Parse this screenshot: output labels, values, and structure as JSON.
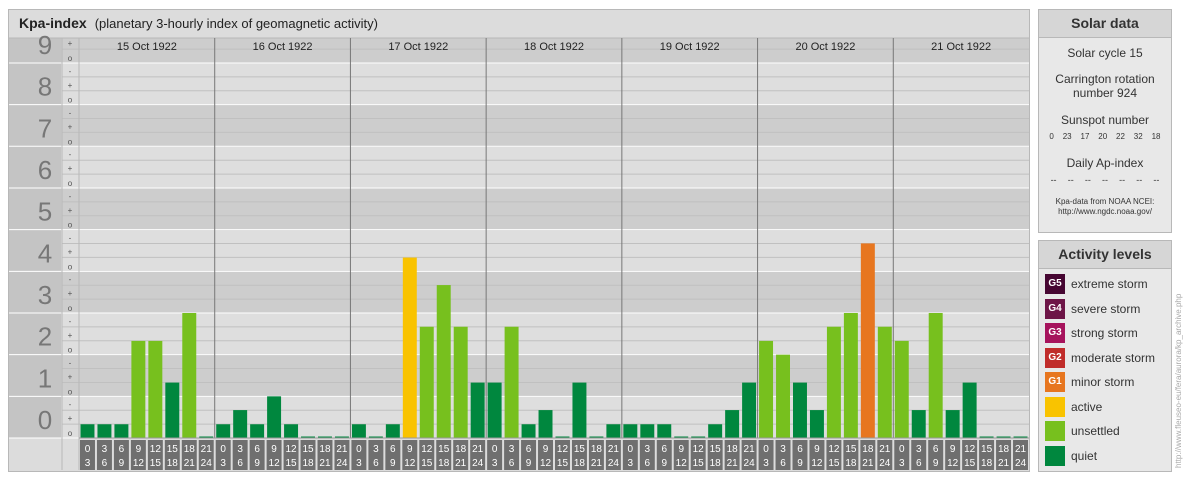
{
  "title": {
    "main": "Kpa-index",
    "sub": "(planetary 3-hourly index of geomagnetic activity)"
  },
  "chart_data": {
    "type": "bar",
    "title": "Kpa-index",
    "subtitle": "(planetary 3-hourly index of geomagnetic activity)",
    "ylim": [
      0,
      9.67
    ],
    "y_ticks": [
      "0",
      "1",
      "2",
      "3",
      "4",
      "5",
      "6",
      "7",
      "8",
      "9"
    ],
    "sub_ticks": [
      "o",
      "+",
      "-"
    ],
    "days": [
      "15 Oct 1922",
      "16 Oct 1922",
      "17 Oct 1922",
      "18 Oct 1922",
      "19 Oct 1922",
      "20 Oct 1922",
      "21 Oct 1922"
    ],
    "hour_labels": [
      [
        "0",
        "3"
      ],
      [
        "3",
        "6"
      ],
      [
        "6",
        "9"
      ],
      [
        "9",
        "12"
      ],
      [
        "12",
        "15"
      ],
      [
        "15",
        "18"
      ],
      [
        "18",
        "21"
      ],
      [
        "21",
        "24"
      ]
    ],
    "values": [
      [
        0.33,
        0.33,
        0.33,
        2.33,
        2.33,
        1.33,
        3.0,
        0
      ],
      [
        0.33,
        0.67,
        0.33,
        1.0,
        0.33,
        0,
        0,
        0
      ],
      [
        0.33,
        0,
        0.33,
        4.33,
        2.67,
        3.67,
        2.67,
        1.33
      ],
      [
        1.33,
        2.67,
        0.33,
        0.67,
        0,
        1.33,
        0,
        0.33
      ],
      [
        0.33,
        0.33,
        0.33,
        0,
        0,
        0.33,
        0.67,
        1.33
      ],
      [
        2.33,
        2.0,
        1.33,
        0.67,
        2.67,
        3.0,
        4.67,
        2.67
      ],
      [
        2.33,
        0.67,
        3.0,
        0.67,
        1.33,
        0,
        0,
        0
      ]
    ],
    "level_colors": {
      "quiet": "#00873e",
      "unsettled": "#77c01e",
      "active": "#f9c300",
      "minor": "#e7761f",
      "moderate": "#c02c2a",
      "strong": "#a6135c",
      "severe": "#6d1547",
      "extreme": "#460632"
    },
    "grid": true
  },
  "solar": {
    "title": "Solar data",
    "cycle": "Solar cycle 15",
    "carrington_1": "Carrington rotation",
    "carrington_2": "number 924",
    "sunspot_label": "Sunspot number",
    "sunspots": [
      "0",
      "23",
      "17",
      "20",
      "22",
      "32",
      "18"
    ],
    "ap_label": "Daily Ap-index",
    "ap_values": [
      "--",
      "--",
      "--",
      "--",
      "--",
      "--",
      "--"
    ],
    "credit_1": "Kpa-data from NOAA NCEI:",
    "credit_2": "http://www.ngdc.noaa.gov/"
  },
  "activity": {
    "title": "Activity levels",
    "levels": [
      {
        "code": "G5",
        "name": "extreme storm",
        "color": "#460632"
      },
      {
        "code": "G4",
        "name": "severe storm",
        "color": "#6d1547"
      },
      {
        "code": "G3",
        "name": "strong storm",
        "color": "#a6135c"
      },
      {
        "code": "G2",
        "name": "moderate storm",
        "color": "#c02c2a"
      },
      {
        "code": "G1",
        "name": "minor storm",
        "color": "#e7761f"
      },
      {
        "code": "",
        "name": "active",
        "color": "#f9c300"
      },
      {
        "code": "",
        "name": "unsettled",
        "color": "#77c01e"
      },
      {
        "code": "",
        "name": "quiet",
        "color": "#00873e"
      }
    ]
  },
  "vertical_credit": "http://www.fleuseo-eu/fera/aurora/kp_archive.php"
}
